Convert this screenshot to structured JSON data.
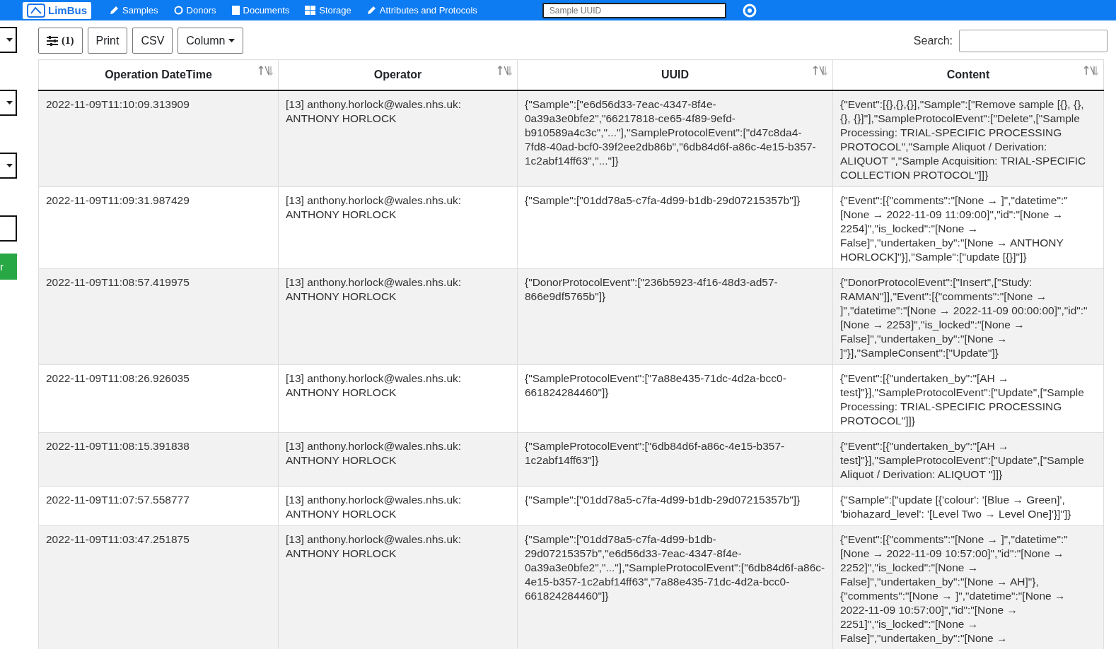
{
  "navbar": {
    "logo": "LimBus",
    "items": [
      {
        "label": "Samples",
        "kind": "pen"
      },
      {
        "label": "Donors",
        "kind": "circle"
      },
      {
        "label": "Documents",
        "kind": "file"
      },
      {
        "label": "Storage",
        "kind": "grid"
      },
      {
        "label": "Attributes and Protocols",
        "kind": "pen"
      }
    ],
    "search": {
      "placeholder": "Sample UUID"
    }
  },
  "sidebar": [
    {
      "kind": "dropdown"
    },
    {
      "kind": "dropdown"
    },
    {
      "kind": "dropdown"
    },
    {
      "kind": "input"
    },
    {
      "kind": "button",
      "label": "r"
    }
  ],
  "toolbar": {
    "filter_count": "(1)",
    "buttons": [
      "Print",
      "CSV"
    ],
    "column_menu": "Column",
    "search_label": "Search:"
  },
  "table": {
    "columns": [
      "Operation DateTime",
      "Operator",
      "UUID",
      "Content"
    ],
    "rows": [
      {
        "datetime": "2022-11-09T11:10:09.313909",
        "operator": "[13] anthony.horlock@wales.nhs.uk: ANTHONY HORLOCK",
        "uuid": "{\"Sample\":[\"e6d56d33-7eac-4347-8f4e-0a39a3e0bfe2\",\"66217818-ce65-4f89-9efd-b910589a4c3c\",\"...\"],\"SampleProtocolEvent\":[\"d47c8da4-7fd8-40ad-bcf0-39f2ee2db86b\",\"6db84d6f-a86c-4e15-b357-1c2abf14ff63\",\"...\"]}",
        "content": "{\"Event\":[{},{},{}],\"Sample\":[\"Remove sample [{}, {}, {}, {}]\"],\"SampleProtocolEvent\":[\"Delete\",[\"Sample Processing: TRIAL-SPECIFIC PROCESSING PROTOCOL\",\"Sample Aliquot / Derivation: ALIQUOT \",\"Sample Acquisition: TRIAL-SPECIFIC COLLECTION PROTOCOL\"]]}"
      },
      {
        "datetime": "2022-11-09T11:09:31.987429",
        "operator": "[13] anthony.horlock@wales.nhs.uk: ANTHONY HORLOCK",
        "uuid": "{\"Sample\":[\"01dd78a5-c7fa-4d99-b1db-29d07215357b\"]}",
        "content": "{\"Event\":[{\"comments\":\"[None → ]\",\"datetime\":\"[None → 2022-11-09 11:09:00]\",\"id\":\"[None → 2254]\",\"is_locked\":\"[None → False]\",\"undertaken_by\":\"[None → ANTHONY HORLOCK]\"}],\"Sample\":[\"update [{}]\"]}"
      },
      {
        "datetime": "2022-11-09T11:08:57.419975",
        "operator": "[13] anthony.horlock@wales.nhs.uk: ANTHONY HORLOCK",
        "uuid": "{\"DonorProtocolEvent\":[\"236b5923-4f16-48d3-ad57-866e9df5765b\"]}",
        "content": "{\"DonorProtocolEvent\":[\"Insert\",[\"Study: RAMAN\"]],\"Event\":[{\"comments\":\"[None → ]\",\"datetime\":\"[None → 2022-11-09 00:00:00]\",\"id\":\"[None → 2253]\",\"is_locked\":\"[None → False]\",\"undertaken_by\":\"[None → ]\"}],\"SampleConsent\":[\"Update\"]}"
      },
      {
        "datetime": "2022-11-09T11:08:26.926035",
        "operator": "[13] anthony.horlock@wales.nhs.uk: ANTHONY HORLOCK",
        "uuid": "{\"SampleProtocolEvent\":[\"7a88e435-71dc-4d2a-bcc0-661824284460\"]}",
        "content": "{\"Event\":[{\"undertaken_by\":\"[AH → test]\"}],\"SampleProtocolEvent\":[\"Update\",[\"Sample Processing: TRIAL-SPECIFIC PROCESSING PROTOCOL\"]]}"
      },
      {
        "datetime": "2022-11-09T11:08:15.391838",
        "operator": "[13] anthony.horlock@wales.nhs.uk: ANTHONY HORLOCK",
        "uuid": "{\"SampleProtocolEvent\":[\"6db84d6f-a86c-4e15-b357-1c2abf14ff63\"]}",
        "content": "{\"Event\":[{\"undertaken_by\":\"[AH → test]\"}],\"SampleProtocolEvent\":[\"Update\",[\"Sample Aliquot / Derivation: ALIQUOT \"]]}"
      },
      {
        "datetime": "2022-11-09T11:07:57.558777",
        "operator": "[13] anthony.horlock@wales.nhs.uk: ANTHONY HORLOCK",
        "uuid": "{\"Sample\":[\"01dd78a5-c7fa-4d99-b1db-29d07215357b\"]}",
        "content": "{\"Sample\":[\"update [{'colour': '[Blue → Green]', 'biohazard_level': '[Level Two → Level One]'}]\"]}"
      },
      {
        "datetime": "2022-11-09T11:03:47.251875",
        "operator": "[13] anthony.horlock@wales.nhs.uk: ANTHONY HORLOCK",
        "uuid": "{\"Sample\":[\"01dd78a5-c7fa-4d99-b1db-29d07215357b\",\"e6d56d33-7eac-4347-8f4e-0a39a3e0bfe2\",\"...\"],\"SampleProtocolEvent\":[\"6db84d6f-a86c-4e15-b357-1c2abf14ff63\",\"7a88e435-71dc-4d2a-bcc0-661824284460\"]}",
        "content": "{\"Event\":[{\"comments\":\"[None → ]\",\"datetime\":\"[None → 2022-11-09 10:57:00]\",\"id\":\"[None → 2252]\",\"is_locked\":\"[None → False]\",\"undertaken_by\":\"[None → AH]\"},{\"comments\":\"[None → ]\",\"datetime\":\"[None → 2022-11-09 10:57:00]\",\"id\":\"[None → 2251]\",\"is_locked\":\"[None → False]\",\"undertaken_by\":\"[None →"
      }
    ]
  }
}
